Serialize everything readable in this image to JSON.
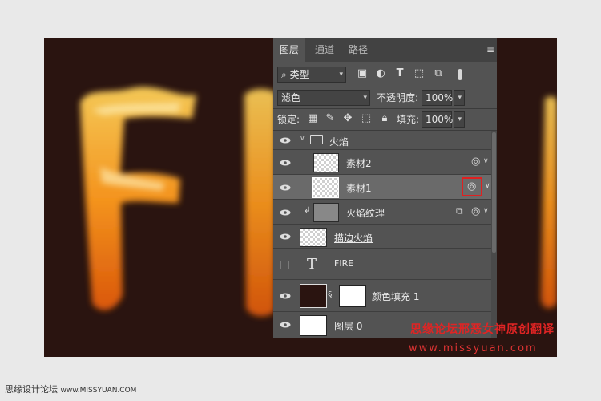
{
  "canvas": {
    "background_color": "#2a1410",
    "fire_color": "#ff9b1f"
  },
  "panel": {
    "tabs": [
      {
        "label": "图层",
        "active": true
      },
      {
        "label": "通道",
        "active": false
      },
      {
        "label": "路径",
        "active": false
      }
    ],
    "filter_kind": "类型",
    "blend_mode": "滤色",
    "opacity_label": "不透明度:",
    "opacity_value": "100%",
    "lock_label": "锁定:",
    "fill_label": "填充:",
    "fill_value": "100%",
    "layers": [
      {
        "name": "火焰",
        "type": "group",
        "visible": true
      },
      {
        "name": "素材2",
        "type": "smart-object",
        "visible": true
      },
      {
        "name": "素材1",
        "type": "smart-object",
        "visible": true,
        "selected": true,
        "highlighted_icon": "blend-if-icon",
        "highlight_color": "#e02020"
      },
      {
        "name": "火焰纹理",
        "type": "smart-object-clipped",
        "visible": true
      },
      {
        "name": "描边火焰",
        "type": "pixel",
        "visible": true
      },
      {
        "name": "FIRE",
        "type": "text",
        "visible": false
      },
      {
        "name": "颜色填充 1",
        "type": "fill",
        "visible": true
      },
      {
        "name": "图层 0",
        "type": "pixel",
        "visible": true
      }
    ]
  },
  "watermark": {
    "text": "思缘论坛邢恶女神原创翻译",
    "url": "www.missyuan.com",
    "color": "#e02424"
  },
  "footer": {
    "text": "思缘设计论坛",
    "site": "www.MISSYUAN.COM"
  }
}
